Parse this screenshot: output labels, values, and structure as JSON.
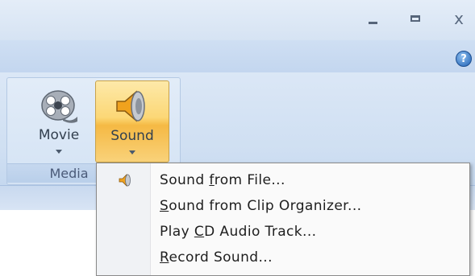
{
  "window_controls": {
    "minimize": "_",
    "maximize": "□",
    "close": "x"
  },
  "help_icon": {
    "glyph": "?",
    "icon": "help-icon"
  },
  "ribbon": {
    "group": {
      "label": "Media",
      "buttons": [
        {
          "label": "Movie",
          "icon": "film-reel-icon",
          "has_dropdown": true,
          "state": "normal"
        },
        {
          "label": "Sound",
          "icon": "speaker-icon",
          "has_dropdown": true,
          "state": "pressed"
        }
      ]
    }
  },
  "sound_menu": {
    "items": [
      {
        "pre": "Sound ",
        "acc": "f",
        "post": "rom File...",
        "icon": "speaker-icon"
      },
      {
        "pre": "",
        "acc": "S",
        "post": "ound from Clip Organizer..."
      },
      {
        "pre": "Play ",
        "acc": "C",
        "post": "D Audio Track..."
      },
      {
        "pre": "",
        "acc": "R",
        "post": "ecord Sound..."
      }
    ]
  },
  "colors": {
    "accent_hover": "#fcd776",
    "ribbon_bg": "#d4e3f4",
    "menu_bg": "#fafafa"
  }
}
